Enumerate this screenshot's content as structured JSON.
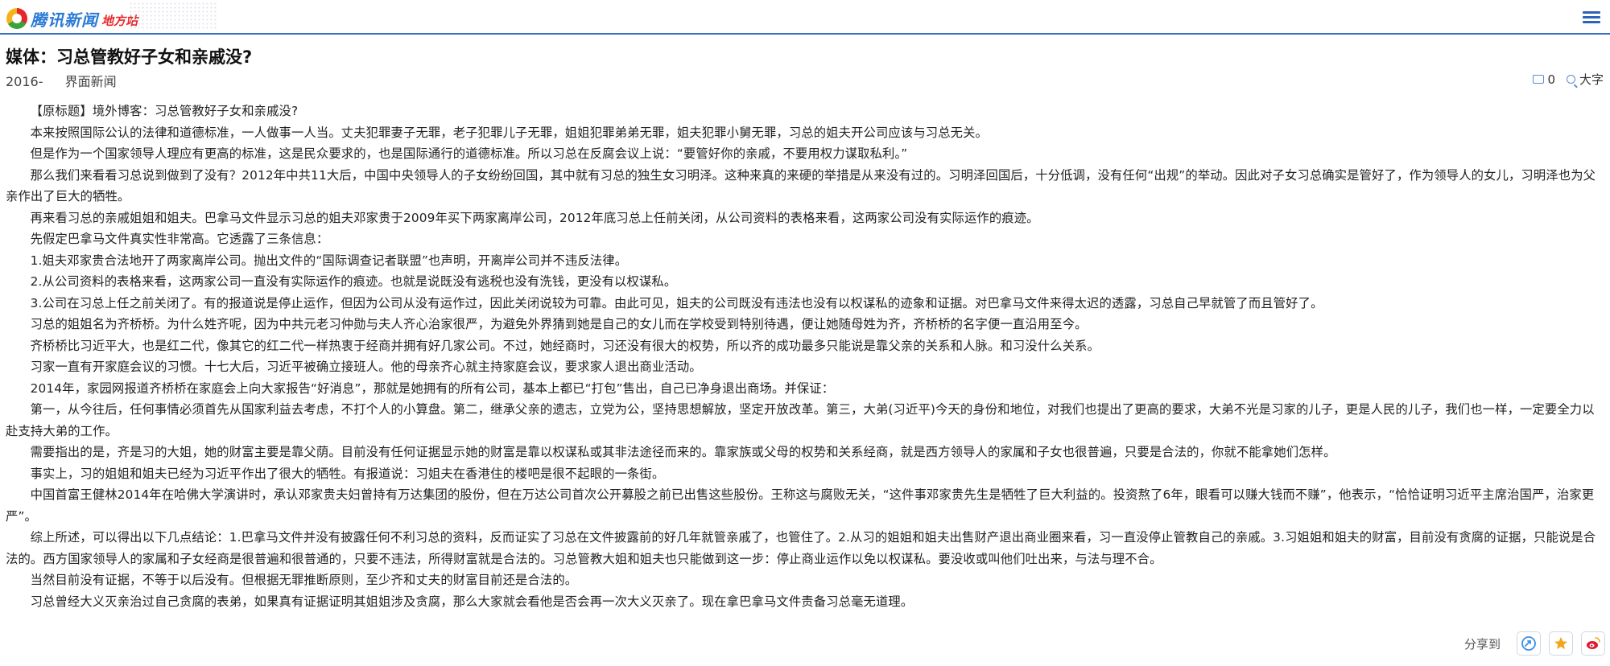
{
  "header": {
    "logo_text": "腾讯新闻",
    "logo_tag": "地方站"
  },
  "article": {
    "title": "媒体：习总管教好子女和亲戚没?",
    "date": "2016-",
    "source": "界面新闻",
    "comment_count": "0",
    "font_size_label": "大字",
    "paragraphs": [
      "【原标题】境外博客：习总管教好子女和亲戚没?",
      "本来按照国际公认的法律和道德标准，一人做事一人当。丈夫犯罪妻子无罪，老子犯罪儿子无罪，姐姐犯罪弟弟无罪，姐夫犯罪小舅无罪，习总的姐夫开公司应该与习总无关。",
      "但是作为一个国家领导人理应有更高的标准，这是民众要求的，也是国际通行的道德标准。所以习总在反腐会议上说：“要管好你的亲戚，不要用权力谋取私利。”",
      "那么我们来看看习总说到做到了没有？2012年中共11大后，中国中央领导人的子女纷纷回国，其中就有习总的独生女习明泽。这种来真的来硬的举措是从来没有过的。习明泽回国后，十分低调，没有任何“出规”的举动。因此对子女习总确实是管好了，作为领导人的女儿，习明泽也为父亲作出了巨大的牺牲。",
      "再来看习总的亲戚姐姐和姐夫。巴拿马文件显示习总的姐夫邓家贵于2009年买下两家离岸公司，2012年底习总上任前关闭，从公司资料的表格来看，这两家公司没有实际运作的痕迹。",
      "先假定巴拿马文件真实性非常高。它透露了三条信息：",
      "1.姐夫邓家贵合法地开了两家离岸公司。抛出文件的“国际调查记者联盟”也声明，开离岸公司并不违反法律。",
      "2.从公司资料的表格来看，这两家公司一直没有实际运作的痕迹。也就是说既没有逃税也没有洗钱，更没有以权谋私。",
      "3.公司在习总上任之前关闭了。有的报道说是停止运作，但因为公司从没有运作过，因此关闭说较为可靠。由此可见，姐夫的公司既没有违法也没有以权谋私的迹象和证据。对巴拿马文件来得太迟的透露，习总自己早就管了而且管好了。",
      "习总的姐姐名为齐桥桥。为什么姓齐呢，因为中共元老习仲勋与夫人齐心治家很严，为避免外界猜到她是自己的女儿而在学校受到特别待遇，便让她随母姓为齐，齐桥桥的名字便一直沿用至今。",
      "齐桥桥比习近平大，也是红二代，像其它的红二代一样热衷于经商并拥有好几家公司。不过，她经商时，习还没有很大的权势，所以齐的成功最多只能说是靠父亲的关系和人脉。和习没什么关系。",
      "习家一直有开家庭会议的习惯。十七大后，习近平被确立接班人。他的母亲齐心就主持家庭会议，要求家人退出商业活动。",
      "2014年，家园网报道齐桥桥在家庭会上向大家报告“好消息”，那就是她拥有的所有公司，基本上都已“打包”售出，自己已净身退出商场。并保证：",
      "第一，从今往后，任何事情必须首先从国家利益去考虑，不打个人的小算盘。第二，继承父亲的遗志，立党为公，坚持思想解放，坚定开放改革。第三，大弟(习近平)今天的身份和地位，对我们也提出了更高的要求，大弟不光是习家的儿子，更是人民的儿子，我们也一样，一定要全力以赴支持大弟的工作。",
      "需要指出的是，齐是习的大姐，她的财富主要是靠父荫。目前没有任何证据显示她的财富是靠以权谋私或其非法途径而来的。靠家族或父母的权势和关系经商，就是西方领导人的家属和子女也很普遍，只要是合法的，你就不能拿她们怎样。",
      "事实上，习的姐姐和姐夫已经为习近平作出了很大的牺牲。有报道说：习姐夫在香港住的楼吧是很不起眼的一条街。",
      "中国首富王健林2014年在哈佛大学演讲时，承认邓家贵夫妇曾持有万达集团的股份，但在万达公司首次公开募股之前已出售这些股份。王称这与腐败无关，“这件事邓家贵先生是牺牲了巨大利益的。投资熬了6年，眼看可以赚大钱而不赚”，他表示，“恰恰证明习近平主席治国严，治家更严”。",
      "综上所述，可以得出以下几点结论：1.巴拿马文件并没有披露任何不利习总的资料，反而证实了习总在文件披露前的好几年就管亲戚了，也管住了。2.从习的姐姐和姐夫出售财产退出商业圈来看，习一直没停止管教自己的亲戚。3.习姐姐和姐夫的财富，目前没有贪腐的证据，只能说是合法的。西方国家领导人的家属和子女经商是很普遍和很普通的，只要不违法，所得财富就是合法的。习总管教大姐和姐夫也只能做到这一步：停止商业运作以免以权谋私。要没收或叫他们吐出来，与法与理不合。",
      "当然目前没有证据，不等于以后没有。但根据无罪推断原则，至少齐和丈夫的财富目前还是合法的。",
      "习总曾经大义灭亲治过自己贪腐的表弟，如果真有证据证明其姐姐涉及贪腐，那么大家就会看他是否会再一次大义灭亲了。现在拿巴拿马文件责备习总毫无道理。"
    ]
  },
  "share": {
    "label": "分享到",
    "buttons": [
      "qzone-icon",
      "favorite-star-icon",
      "weibo-icon"
    ]
  },
  "colors": {
    "accent": "#3a6fc4",
    "menu": "#2c62b8",
    "favorite": "#f2a51a",
    "weibo": "#e6162d"
  }
}
